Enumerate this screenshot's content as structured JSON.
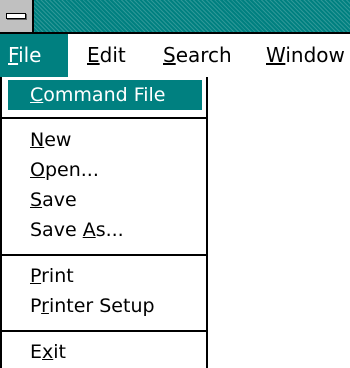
{
  "titlebar": {
    "system_menu_icon": "window-control-menu-icon",
    "colors": {
      "active": "#008080"
    }
  },
  "menubar": {
    "items": [
      {
        "pre": "",
        "u": "F",
        "post": "ile"
      },
      {
        "pre": "",
        "u": "E",
        "post": "dit"
      },
      {
        "pre": "",
        "u": "S",
        "post": "earch"
      },
      {
        "pre": "",
        "u": "W",
        "post": "indow"
      }
    ]
  },
  "file_menu": {
    "items": [
      {
        "pre": "",
        "u": "C",
        "post": "ommand File"
      },
      {
        "pre": "",
        "u": "N",
        "post": "ew"
      },
      {
        "pre": "",
        "u": "O",
        "post": "pen..."
      },
      {
        "pre": "",
        "u": "S",
        "post": "ave"
      },
      {
        "pre": "Save ",
        "u": "A",
        "post": "s..."
      },
      {
        "pre": "",
        "u": "P",
        "post": "rint"
      },
      {
        "pre": "P",
        "u": "r",
        "post": "inter Setup"
      },
      {
        "pre": "E",
        "u": "x",
        "post": "it"
      }
    ]
  }
}
